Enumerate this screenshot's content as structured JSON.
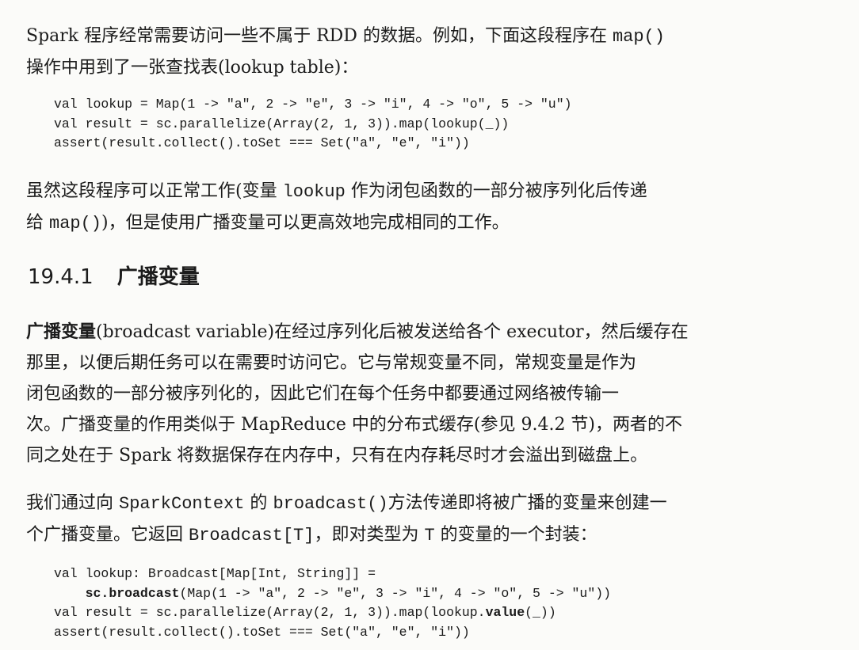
{
  "para1": {
    "line1_pre": "Spark 程序经常需要访问一些不属于 RDD 的数据。例如，下面这段程序在 ",
    "line1_code": "map()",
    "line2": "操作中用到了一张查找表(lookup table)："
  },
  "code1": {
    "line1": "val lookup = Map(1 -> \"a\", 2 -> \"e\", 3 -> \"i\", 4 -> \"o\", 5 -> \"u\")",
    "line2": "val result = sc.parallelize(Array(2, 1, 3)).map(lookup(_))",
    "line3": "assert(result.collect().toSet === Set(\"a\", \"e\", \"i\"))"
  },
  "para2": {
    "line1_pre": "虽然这段程序可以正常工作(变量 ",
    "line1_code": "lookup",
    "line1_post": " 作为闭包函数的一部分被序列化后传递",
    "line2_pre": "给 ",
    "line2_code": "map()",
    "line2_post": ")，但是使用广播变量可以更高效地完成相同的工作。"
  },
  "section": {
    "number": "19.4.1",
    "title": "广播变量"
  },
  "para3": {
    "term": "广播变量",
    "line1_post": "(broadcast variable)在经过序列化后被发送给各个 executor，然后缓存在",
    "line2": "那里，以便后期任务可以在需要时访问它。它与常规变量不同，常规变量是作为",
    "line3": "闭包函数的一部分被序列化的，因此它们在每个任务中都要通过网络被传输一",
    "line4": "次。广播变量的作用类似于 MapReduce 中的分布式缓存(参见 9.4.2 节)，两者的不",
    "line5": "同之处在于 Spark 将数据保存在内存中，只有在内存耗尽时才会溢出到磁盘上。"
  },
  "para4": {
    "line1_pre": "我们通过向 ",
    "line1_code1": "SparkContext",
    "line1_mid": " 的 ",
    "line1_code2": "broadcast()",
    "line1_post": "方法传递即将被广播的变量来创建一",
    "line2_pre": "个广播变量。它返回 ",
    "line2_code1": "Broadcast[T]",
    "line2_mid": "，即对类型为 ",
    "line2_code2": "T",
    "line2_post": " 的变量的一个封装："
  },
  "code2": {
    "line1": "val lookup: Broadcast[Map[Int, String]] =",
    "line2_indent": "    ",
    "line2_bold": "sc.broadcast",
    "line2_rest": "(Map(1 -> \"a\", 2 -> \"e\", 3 -> \"i\", 4 -> \"o\", 5 -> \"u\"))",
    "line3_pre": "val result = sc.parallelize(Array(2, 1, 3)).map(lookup.",
    "line3_bold": "value",
    "line3_post": "(_))",
    "line4": "assert(result.collect().toSet === Set(\"a\", \"e\", \"i\"))"
  }
}
